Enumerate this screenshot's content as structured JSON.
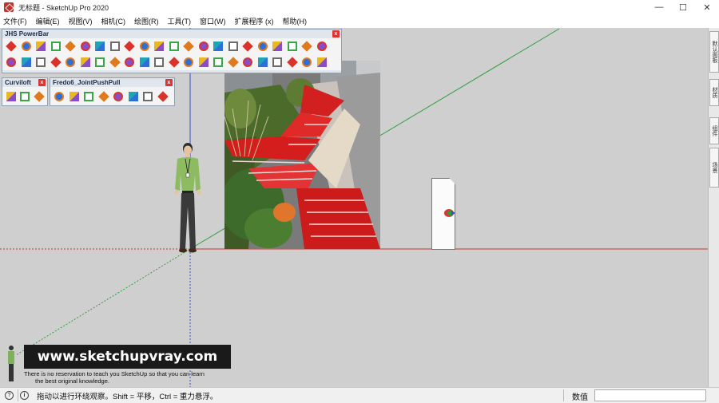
{
  "window": {
    "title": "无标题 - SketchUp Pro 2020",
    "controls": {
      "minimize": "—",
      "maximize": "☐",
      "close": "✕"
    }
  },
  "menu": [
    "文件(F)",
    "编辑(E)",
    "视图(V)",
    "相机(C)",
    "绘图(R)",
    "工具(T)",
    "窗口(W)",
    "扩展程序 (x)",
    "帮助(H)"
  ],
  "toolbars": {
    "jhs": {
      "title": "JHS PowerBar",
      "close": "x"
    },
    "curviloft": {
      "title": "Curviloft",
      "close": "x"
    },
    "fredo": {
      "title": "Fredo6_JointPushPull",
      "close": "x"
    }
  },
  "right_tray": {
    "tabs": [
      "默认面板",
      "材质",
      "组件",
      "场景"
    ]
  },
  "watermark": {
    "url": "www.sketchupvray.com",
    "line1": "There is no reservation to teach you SketchUp so that you can learn",
    "line2": "the best original knowledge."
  },
  "status": {
    "message": "拖动以进行环绕观察。Shift = 平移，Ctrl = 重力悬浮。",
    "measure_label": "数值",
    "measure_value": ""
  },
  "colors": {
    "viewport_bg": "#cfcfcf",
    "red_axis": "#c0392b",
    "green_axis": "#2e9e3c",
    "blue_axis": "#3a4fd0"
  }
}
